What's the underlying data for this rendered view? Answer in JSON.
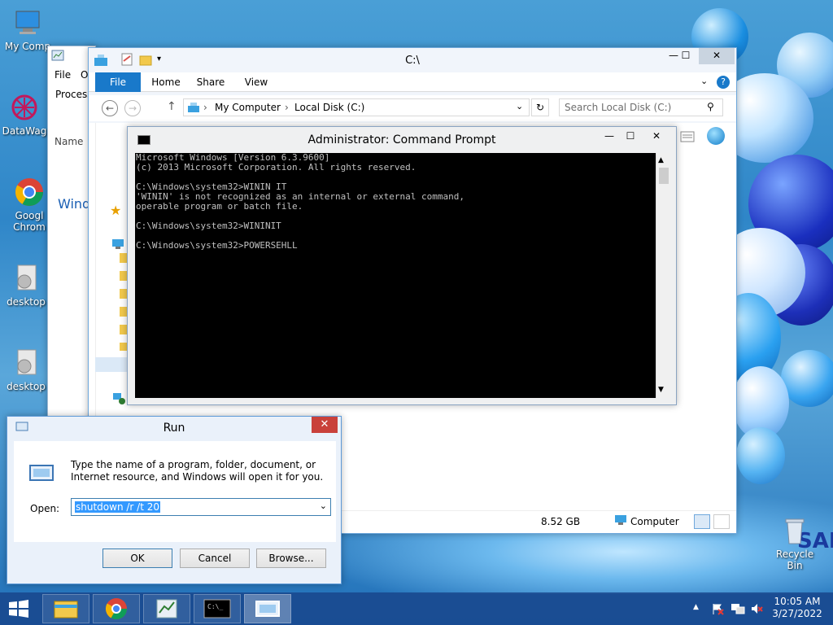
{
  "desktop": {
    "icons": [
      {
        "label": "My Comp"
      },
      {
        "label": "DataWag"
      },
      {
        "label": "Googl"
      },
      {
        "label": "Chrom"
      },
      {
        "label": "desktop"
      },
      {
        "label": "desktop"
      },
      {
        "label": "Recycle Bin"
      }
    ]
  },
  "taskmanager": {
    "menu_file": "File",
    "menu_o": "O",
    "tab_process": "Process",
    "col_name": "Name",
    "group_windows": "Wind"
  },
  "explorer": {
    "title": "C:\\",
    "tabs": [
      "File",
      "Home",
      "Share",
      "View"
    ],
    "breadcrumb": [
      "My Computer",
      "Local Disk (C:)"
    ],
    "search_placeholder": "Search Local Disk (C:)",
    "status_size": "8.52 GB",
    "status_location": "Computer"
  },
  "cmd": {
    "title": "Administrator: Command Prompt",
    "output": "Microsoft Windows [Version 6.3.9600]\n(c) 2013 Microsoft Corporation. All rights reserved.\n\nC:\\Windows\\system32>WININ IT\n'WININ' is not recognized as an internal or external command,\noperable program or batch file.\n\nC:\\Windows\\system32>WININIT\n\nC:\\Windows\\system32>POWERSEHLL"
  },
  "run": {
    "title": "Run",
    "description": "Type the name of a program, folder, document, or Internet resource, and Windows will open it for you.",
    "open_label": "Open:",
    "open_value": "shutdown /r  /t 20",
    "ok_label": "OK",
    "cancel_label": "Cancel",
    "browse_label": "Browse..."
  },
  "clock": {
    "time": "10:05 AM",
    "date": "3/27/2022"
  },
  "brand": "SAM"
}
